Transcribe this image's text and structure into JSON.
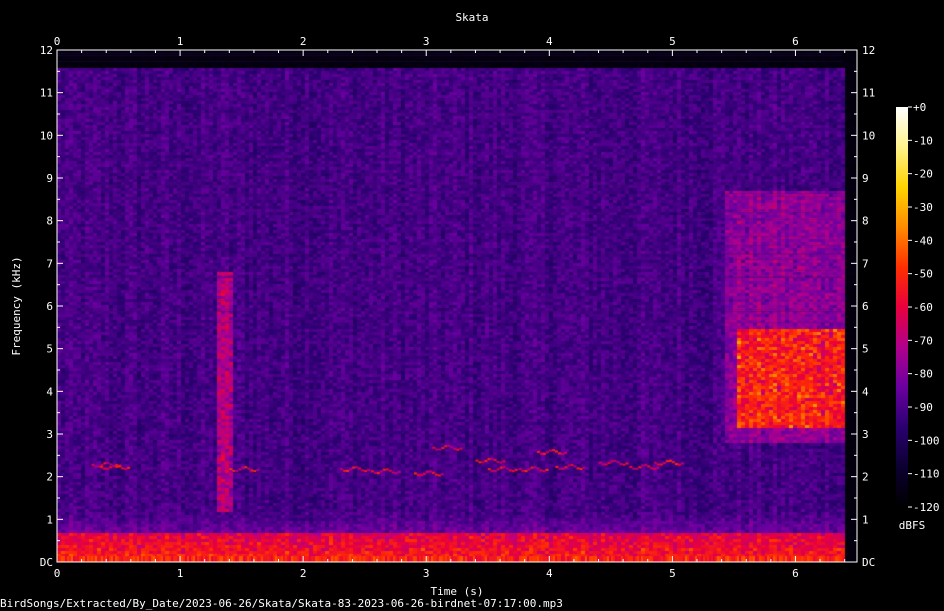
{
  "chart_data": {
    "type": "heatmap",
    "title": "Skata",
    "xlabel": "Time (s)",
    "ylabel": "Frequency (kHz)",
    "xlim": [
      0,
      6.5
    ],
    "ylim": [
      0,
      12
    ],
    "x_ticks": [
      "0",
      "1",
      "2",
      "3",
      "4",
      "5",
      "6"
    ],
    "y_ticks": [
      "DC",
      "1",
      "2",
      "3",
      "4",
      "5",
      "6",
      "7",
      "8",
      "9",
      "10",
      "11",
      "12"
    ],
    "colorbar": {
      "label": "dBFS",
      "ticks": [
        "+0",
        "-10",
        "-20",
        "-30",
        "-40",
        "-50",
        "-60",
        "-70",
        "-80",
        "-90",
        "-100",
        "-110",
        "-120"
      ],
      "range": [
        -120,
        0
      ],
      "colors": [
        "#000000",
        "#0c0030",
        "#2a0070",
        "#6a00a0",
        "#b0008c",
        "#e8003c",
        "#ff3000",
        "#ff8c00",
        "#ffd400",
        "#fff28c",
        "#ffffff"
      ]
    },
    "features": [
      {
        "kind": "broadband",
        "t": [
          1.3,
          1.42
        ],
        "f": [
          1.2,
          6.8
        ],
        "level": 0.32
      },
      {
        "kind": "broadband",
        "t": [
          5.4,
          6.5
        ],
        "f": [
          2.8,
          8.7
        ],
        "level": 0.22
      },
      {
        "kind": "hotspot",
        "t": [
          5.5,
          6.4
        ],
        "f": [
          3.2,
          5.5
        ],
        "level": 0.42
      },
      {
        "kind": "tonal",
        "t": [
          0.25,
          4.9
        ],
        "f": [
          2.1,
          2.4
        ],
        "level": 0.35
      },
      {
        "kind": "lowfreq",
        "t": [
          0,
          6.5
        ],
        "f": [
          0,
          0.7
        ],
        "level": 0.55
      }
    ]
  },
  "footer": {
    "path": "BirdSongs/Extracted/By_Date/2023-06-26/Skata/Skata-83-2023-06-26-birdnet-07:17:00.mp3"
  }
}
